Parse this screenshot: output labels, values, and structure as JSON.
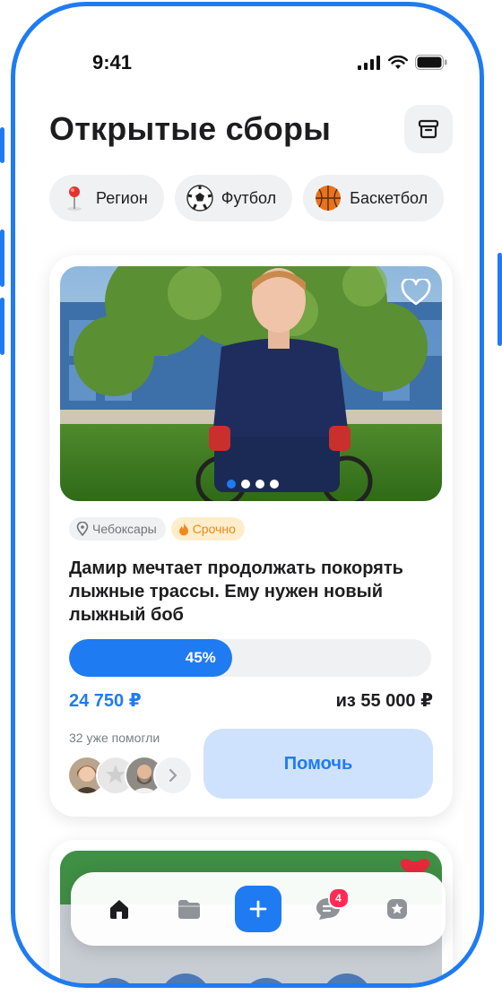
{
  "status_bar": {
    "time": "9:41"
  },
  "header": {
    "title": "Открытые сборы"
  },
  "filters": [
    {
      "label": "Регион",
      "icon": "pin-icon"
    },
    {
      "label": "Футбол",
      "icon": "soccer-ball-icon"
    },
    {
      "label": "Баскетбол",
      "icon": "basketball-icon"
    }
  ],
  "card": {
    "location": "Чебоксары",
    "urgent_label": "Срочно",
    "title": "Дамир мечтает продолжать покорять лыжные трассы. Ему нужен новый лыжный боб",
    "progress": 0.45,
    "progress_label": "45%",
    "raised": "24 750 ₽",
    "goal": "из 55 000 ₽",
    "helped": "32 уже помогли",
    "help_button": "Помочь",
    "carousel": {
      "count": 4,
      "active": 0
    }
  },
  "tabbar": {
    "tabs": [
      {
        "icon": "home-icon"
      },
      {
        "icon": "folder-icon"
      },
      {
        "icon": "plus-icon"
      },
      {
        "icon": "chat-icon",
        "badge": "4"
      },
      {
        "icon": "star-badge-icon"
      }
    ]
  },
  "colors": {
    "accent": "#1f7bf2",
    "urgent": "#e98a14",
    "badge": "#ff2d55"
  }
}
